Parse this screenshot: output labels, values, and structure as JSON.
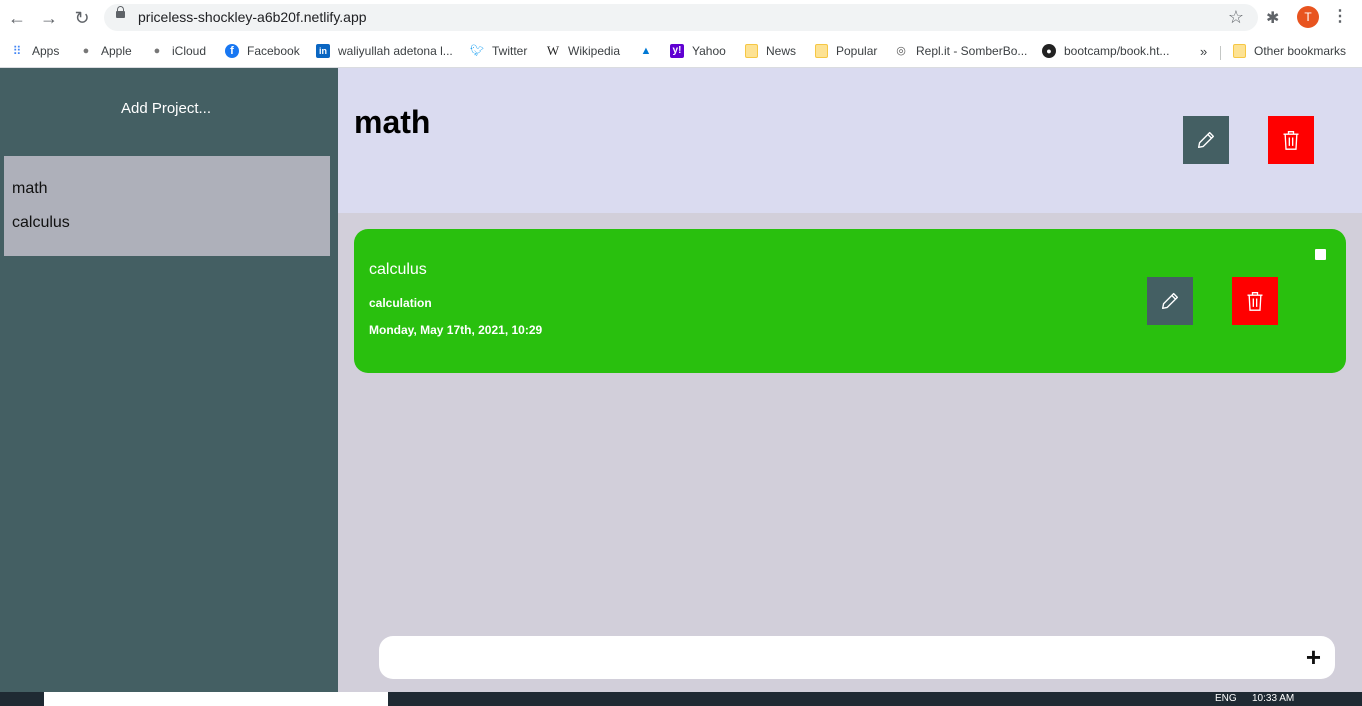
{
  "browser": {
    "url": "priceless-shockley-a6b20f.netlify.app",
    "avatar_letter": "T",
    "bookmarks": [
      {
        "label": "Apps",
        "icon": "apps-grid-icon"
      },
      {
        "label": "Apple",
        "icon": "apple-icon"
      },
      {
        "label": "iCloud",
        "icon": "apple-icon"
      },
      {
        "label": "Facebook",
        "icon": "facebook-icon"
      },
      {
        "label": "waliyullah adetona l...",
        "icon": "linkedin-icon"
      },
      {
        "label": "Twitter",
        "icon": "twitter-icon"
      },
      {
        "label": "Wikipedia",
        "icon": "wikipedia-icon"
      },
      {
        "label": "",
        "icon": "azure-icon"
      },
      {
        "label": "Yahoo",
        "icon": "yahoo-icon"
      },
      {
        "label": "News",
        "icon": "folder-icon"
      },
      {
        "label": "Popular",
        "icon": "folder-icon"
      },
      {
        "label": "Repl.it - SomberBo...",
        "icon": "replit-icon"
      },
      {
        "label": "bootcamp/book.ht...",
        "icon": "github-icon"
      }
    ],
    "overflow": "»",
    "other_bookmarks": "Other bookmarks"
  },
  "sidebar": {
    "add_project": "Add Project...",
    "projects": [
      "math",
      "calculus"
    ]
  },
  "main": {
    "project_title": "math",
    "todos": [
      {
        "title": "calculus",
        "description": "calculation",
        "due": "Monday, May 17th, 2021, 10:29",
        "color": "#29c00e",
        "done": false
      }
    ],
    "add_button": "+"
  },
  "taskbar": {
    "lang": "ENG",
    "time": "10:33 AM"
  },
  "colors": {
    "sidebar": "#445f63",
    "header": "#dadbf0",
    "main_bg": "#d2cfda",
    "delete": "#ff0000",
    "edit": "#445f63"
  }
}
